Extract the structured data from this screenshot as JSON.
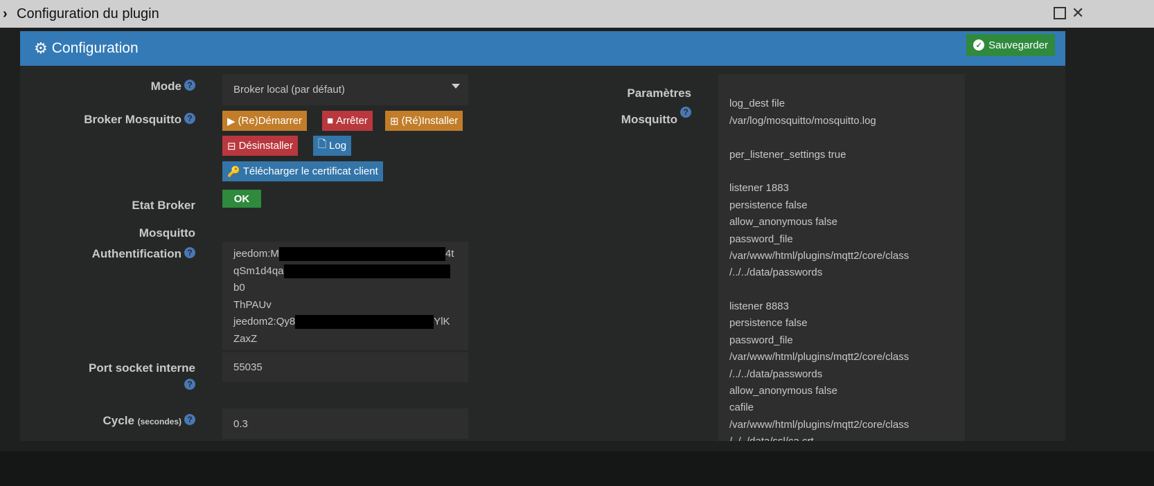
{
  "window": {
    "title": "Configuration du plugin"
  },
  "panel": {
    "title": "Configuration",
    "save_label": "Sauvegarder"
  },
  "labels": {
    "mode": "Mode",
    "broker": "Broker Mosquitto",
    "etat1": "Etat Broker",
    "etat2": "Mosquitto",
    "auth": "Authentification",
    "port": "Port socket interne",
    "cycle": "Cycle",
    "cycle_unit": "(secondes)",
    "params1": "Paramètres",
    "params2": "Mosquitto"
  },
  "mode_select": {
    "value": "Broker local (par défaut)"
  },
  "buttons": {
    "restart": "(Re)Démarrer",
    "stop": "Arrêter",
    "install": "(Ré)Installer",
    "uninstall": "Désinstaller",
    "log": "Log",
    "cert": "Télécharger le certificat client"
  },
  "etat": {
    "status": "OK",
    "color": "#2f8a3d"
  },
  "auth": {
    "l1a": "jeedom:M",
    "l1b": "4t",
    "l2a": "qSm1d4qa",
    "l2b": "b0",
    "l3": "ThPAUv",
    "l4a": "jeedom2:Qy8",
    "l4b": "YlK",
    "l5": "ZaxZ"
  },
  "port": {
    "value": "55035"
  },
  "cycle": {
    "value": "0.3"
  },
  "mosquitto_params": [
    "",
    "log_dest file",
    "/var/log/mosquitto/mosquitto.log",
    "",
    "per_listener_settings true",
    "",
    "listener 1883",
    "persistence false",
    "allow_anonymous false",
    "password_file",
    "/var/www/html/plugins/mqtt2/core/class",
    "/../../data/passwords",
    "",
    "listener 8883",
    "persistence false",
    "password_file",
    "/var/www/html/plugins/mqtt2/core/class",
    "/../../data/passwords",
    "allow_anonymous false",
    "cafile",
    "/var/www/html/plugins/mqtt2/core/class",
    "/../../data/ssl/ca.crt"
  ]
}
